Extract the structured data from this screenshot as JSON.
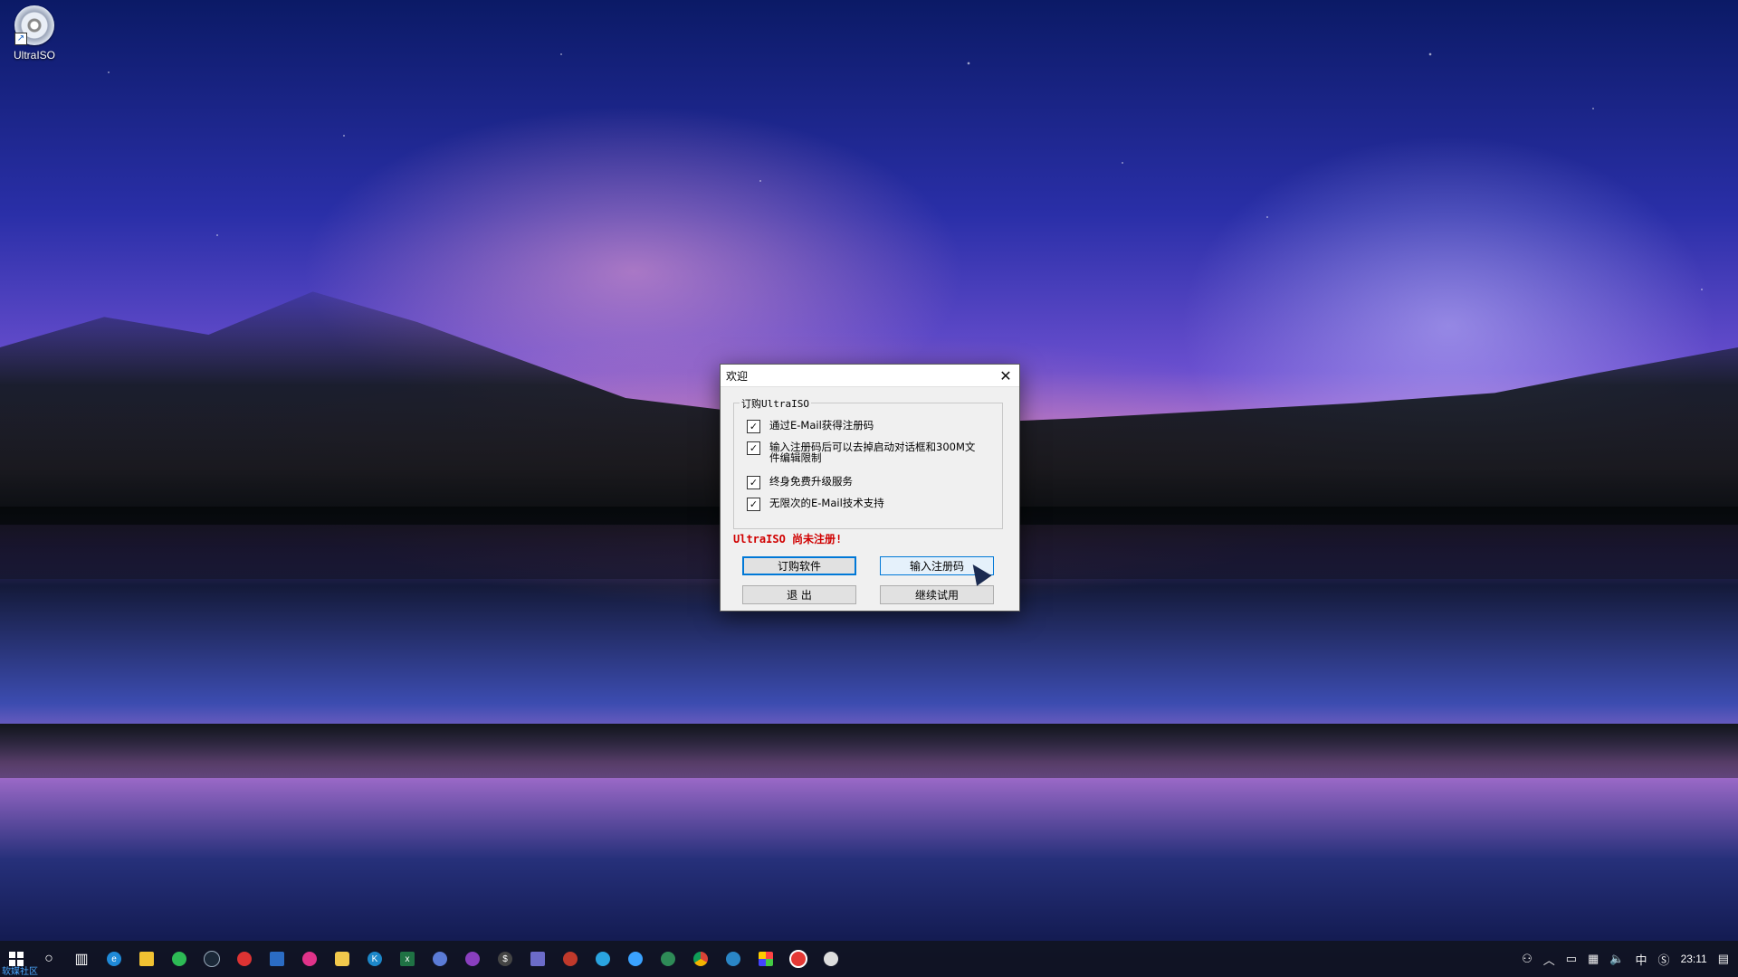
{
  "desktop": {
    "icon": {
      "name": "UltraISO"
    }
  },
  "dialog": {
    "title": "欢迎",
    "group_title": "订购UltraISO",
    "options": [
      {
        "label": "通过E-Mail获得注册码",
        "checked": true
      },
      {
        "label": "输入注册码后可以去掉启动对话框和300M文件编辑限制",
        "checked": true
      },
      {
        "label": "终身免费升级服务",
        "checked": true
      },
      {
        "label": "无限次的E-Mail技术支持",
        "checked": true
      }
    ],
    "warning": "UltraISO 尚未注册!",
    "buttons": {
      "buy": "订购软件",
      "enter_code": "输入注册码",
      "exit": "退 出",
      "trial": "继续试用"
    }
  },
  "taskbar": {
    "apps": [
      "start",
      "search",
      "task-view",
      "edge",
      "file-explorer",
      "wechat",
      "steam",
      "app-red",
      "app-blue",
      "app-pink",
      "app-yellow",
      "app-k",
      "app-excel",
      "app-circle",
      "app-game",
      "app-dollar",
      "app-notes",
      "app-red-circle",
      "app-media",
      "app-browser",
      "app-globe",
      "chrome",
      "app-shield",
      "app-colorful",
      "app-record",
      "ultraiso"
    ],
    "tray": {
      "ime": "中",
      "time": "23:11"
    },
    "corner_text": "软媒社区"
  }
}
